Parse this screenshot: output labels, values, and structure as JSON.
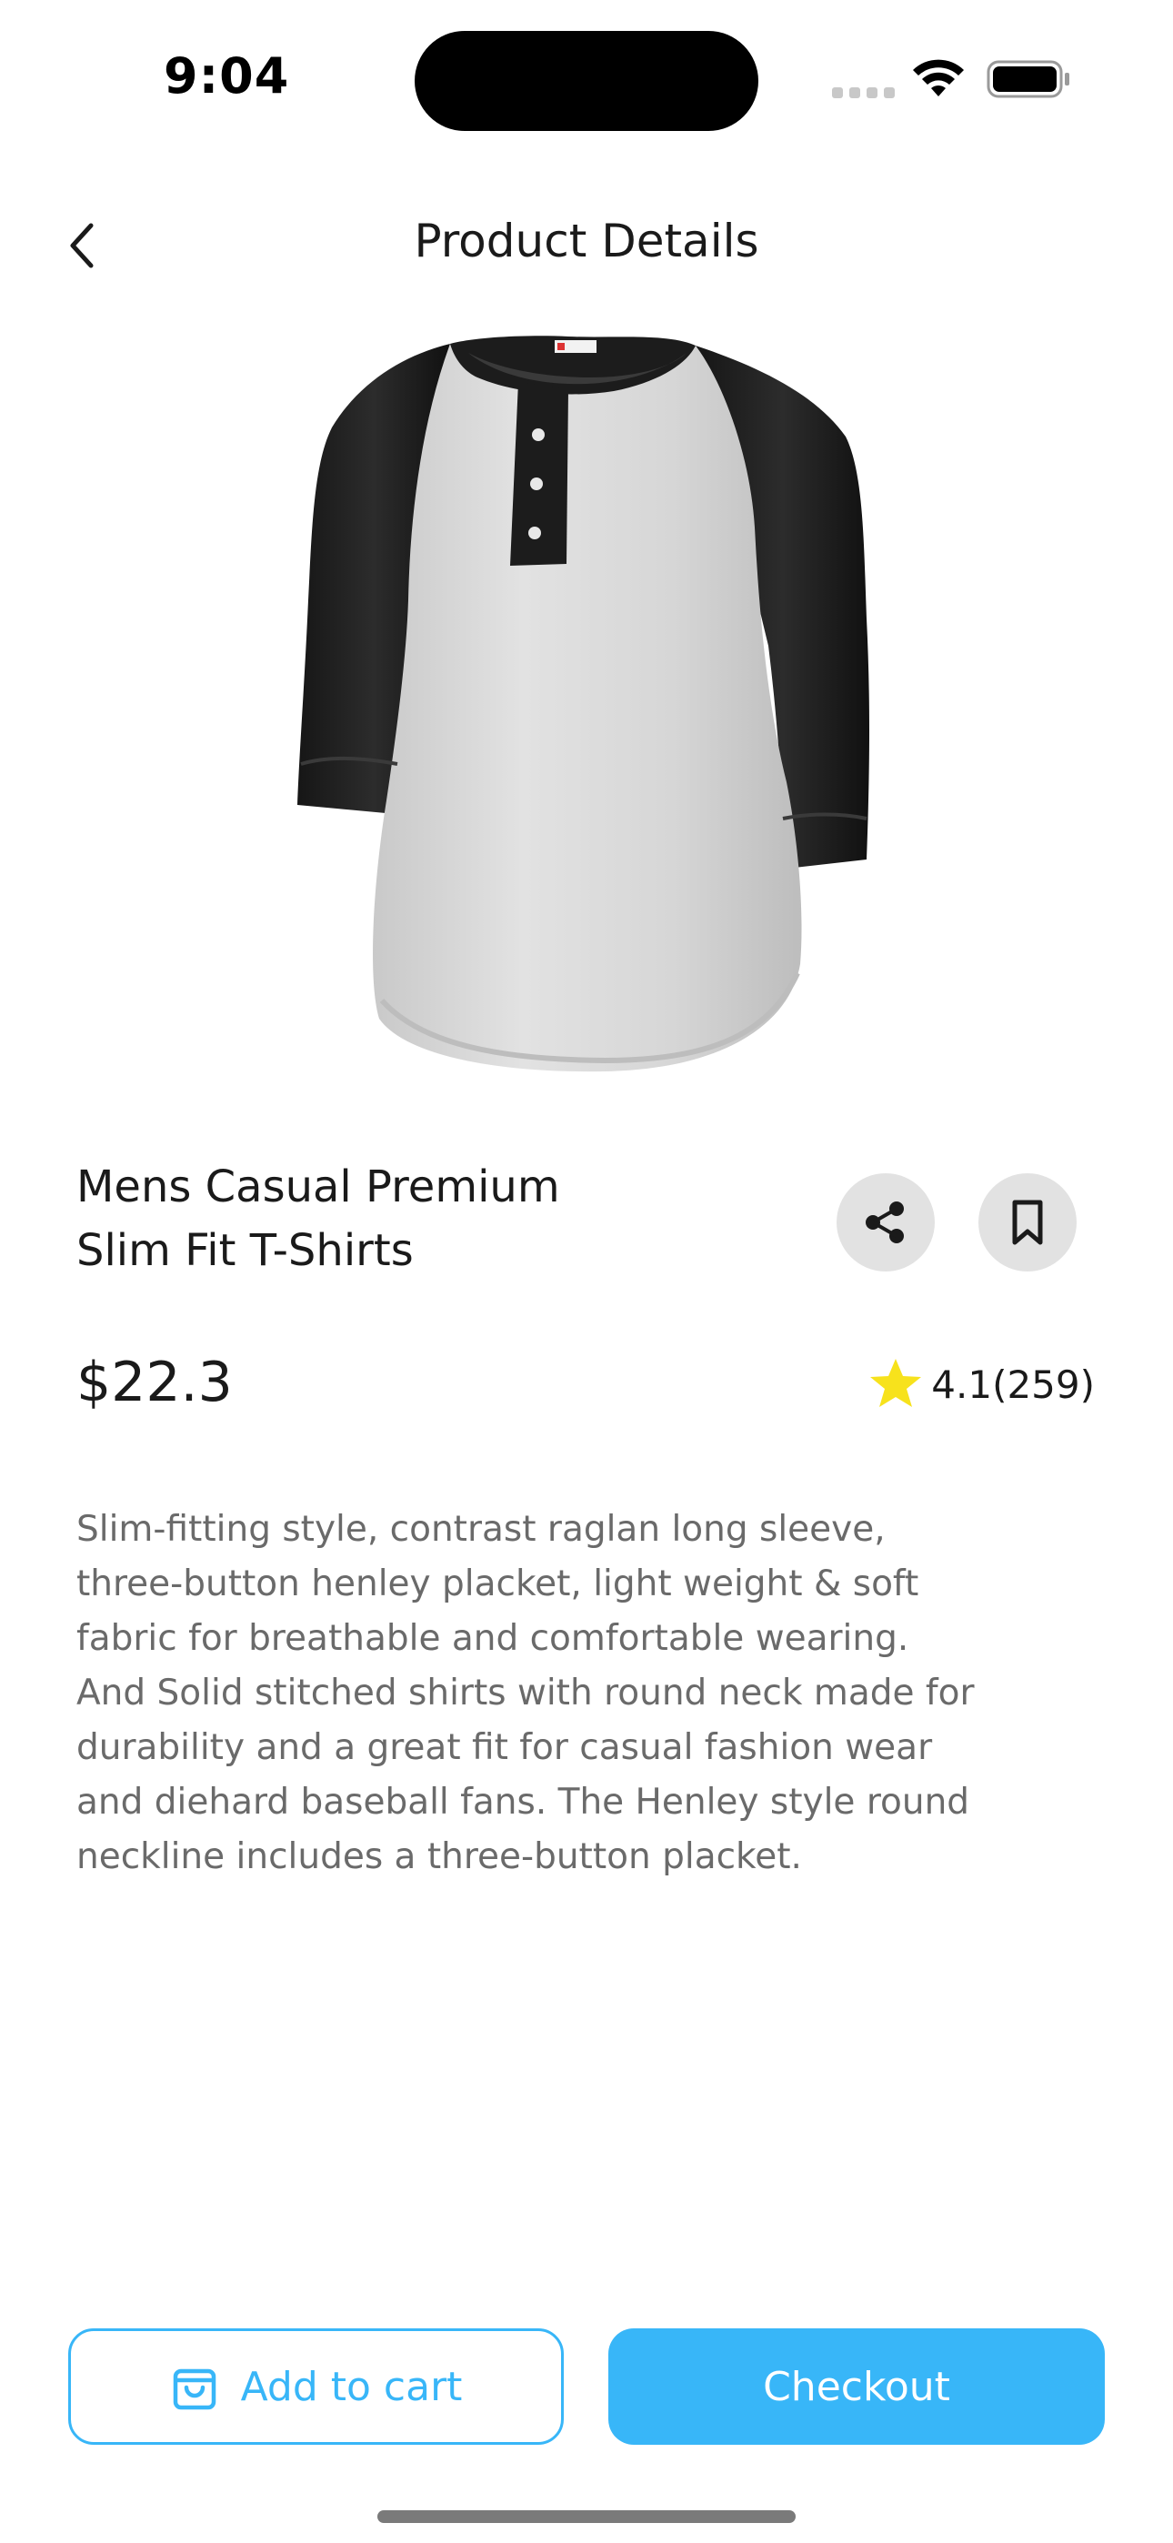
{
  "status_bar": {
    "time": "9:04"
  },
  "header": {
    "title": "Product Details",
    "back_icon": "chevron-left-icon"
  },
  "product": {
    "image_icon": "henley-tshirt-image",
    "name_lines": [
      "Mens Casual Premium",
      "Slim Fit T-Shirts"
    ],
    "price": "$22.3",
    "rating": "4.1",
    "review_count": "(259)",
    "description_lines": [
      "Slim-fitting style, contrast raglan long sleeve,",
      "three-button henley placket, light weight & soft",
      "fabric for breathable and comfortable wearing.",
      "And Solid stitched shirts with round neck made for",
      "durability and a great fit for casual fashion wear",
      "and diehard baseball fans. The Henley style round",
      "neckline includes a three-button placket."
    ]
  },
  "actions": {
    "share_icon": "share-icon",
    "bookmark_icon": "bookmark-icon",
    "add_to_cart_label": "Add to cart",
    "cart_icon": "shopping-bag-icon",
    "checkout_label": "Checkout"
  },
  "colors": {
    "accent": "#38b6f8",
    "star": "#f7e21c",
    "icon_button_bg": "#e2e2e2",
    "description_text": "#6a6a6a"
  }
}
